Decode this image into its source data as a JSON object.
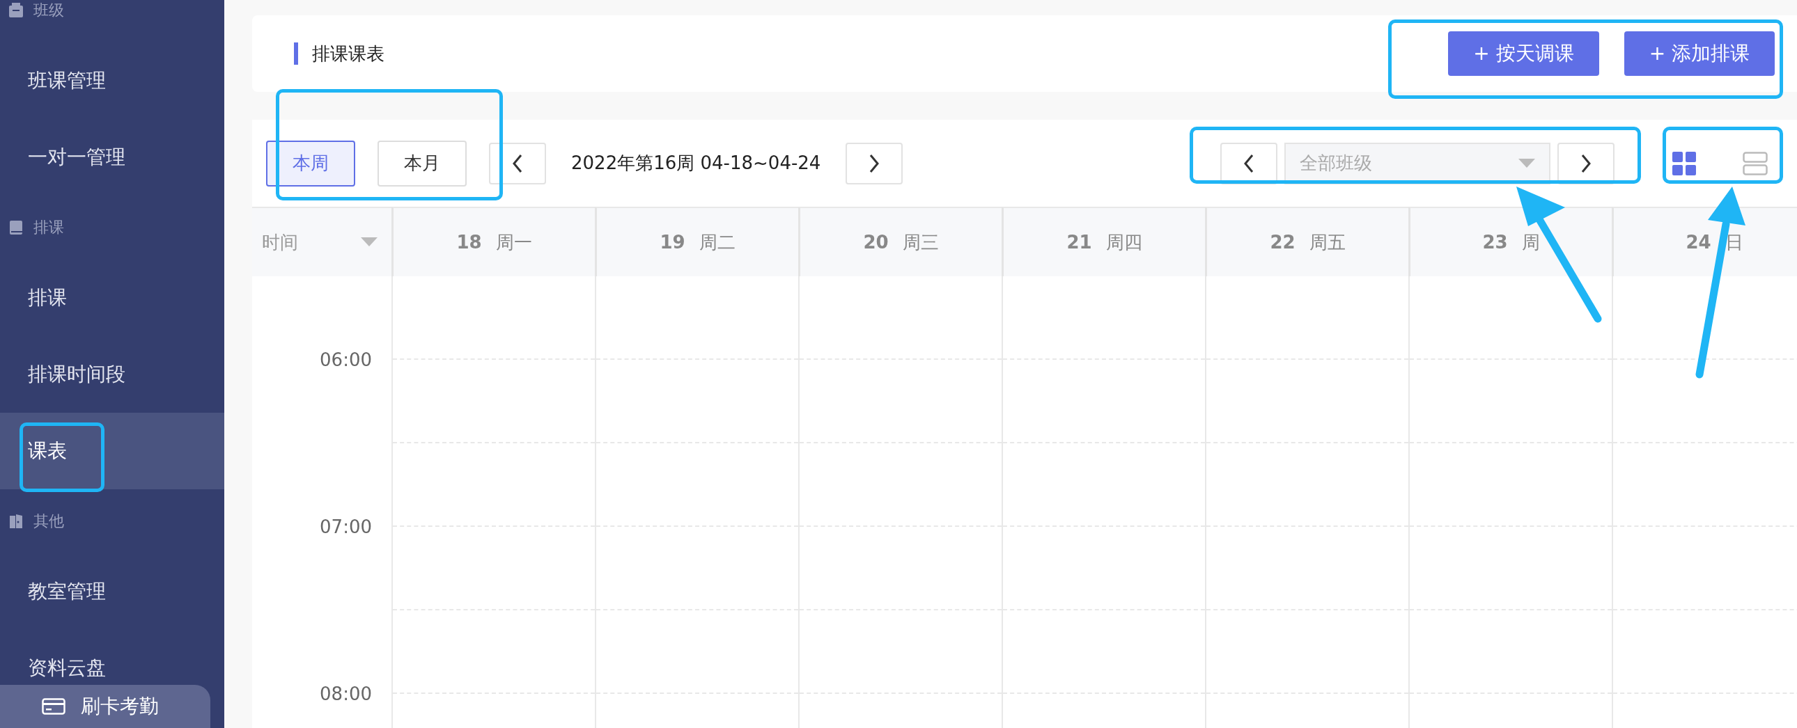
{
  "sidebar": {
    "items": [
      {
        "kind": "section",
        "label": "班级"
      },
      {
        "kind": "link",
        "label": "班课管理",
        "selected": false
      },
      {
        "kind": "link",
        "label": "一对一管理",
        "selected": false
      },
      {
        "kind": "section",
        "label": "排课"
      },
      {
        "kind": "link",
        "label": "排课",
        "selected": false
      },
      {
        "kind": "link",
        "label": "排课时间段",
        "selected": false
      },
      {
        "kind": "link",
        "label": "课表",
        "selected": true
      },
      {
        "kind": "section",
        "label": "其他"
      },
      {
        "kind": "link",
        "label": "教室管理",
        "selected": false
      },
      {
        "kind": "link",
        "label": "资料云盘",
        "selected": false
      }
    ],
    "footer_button": {
      "label": "刷卡考勤"
    }
  },
  "header": {
    "title": "排课课表",
    "buttons": [
      "+ 按天调课",
      "+ 添加排课"
    ]
  },
  "toolbar": {
    "range_tabs": [
      {
        "label": "本周",
        "selected": true
      },
      {
        "label": "本月",
        "selected": false
      }
    ],
    "period": "2022年第16周 04-18~04-24",
    "class_select": {
      "placeholder": "全部班级"
    },
    "view_modes": [
      {
        "kind": "grid",
        "selected": true
      },
      {
        "kind": "list",
        "selected": false
      }
    ]
  },
  "calendar": {
    "time_header": "时间",
    "days": [
      {
        "date": "18",
        "weekday": "周一"
      },
      {
        "date": "19",
        "weekday": "周二"
      },
      {
        "date": "20",
        "weekday": "周三"
      },
      {
        "date": "21",
        "weekday": "周四"
      },
      {
        "date": "22",
        "weekday": "周五"
      },
      {
        "date": "23",
        "weekday": "周"
      },
      {
        "date": "24",
        "weekday": "日"
      }
    ],
    "times": [
      "06:00",
      "07:00",
      "08:00"
    ]
  }
}
